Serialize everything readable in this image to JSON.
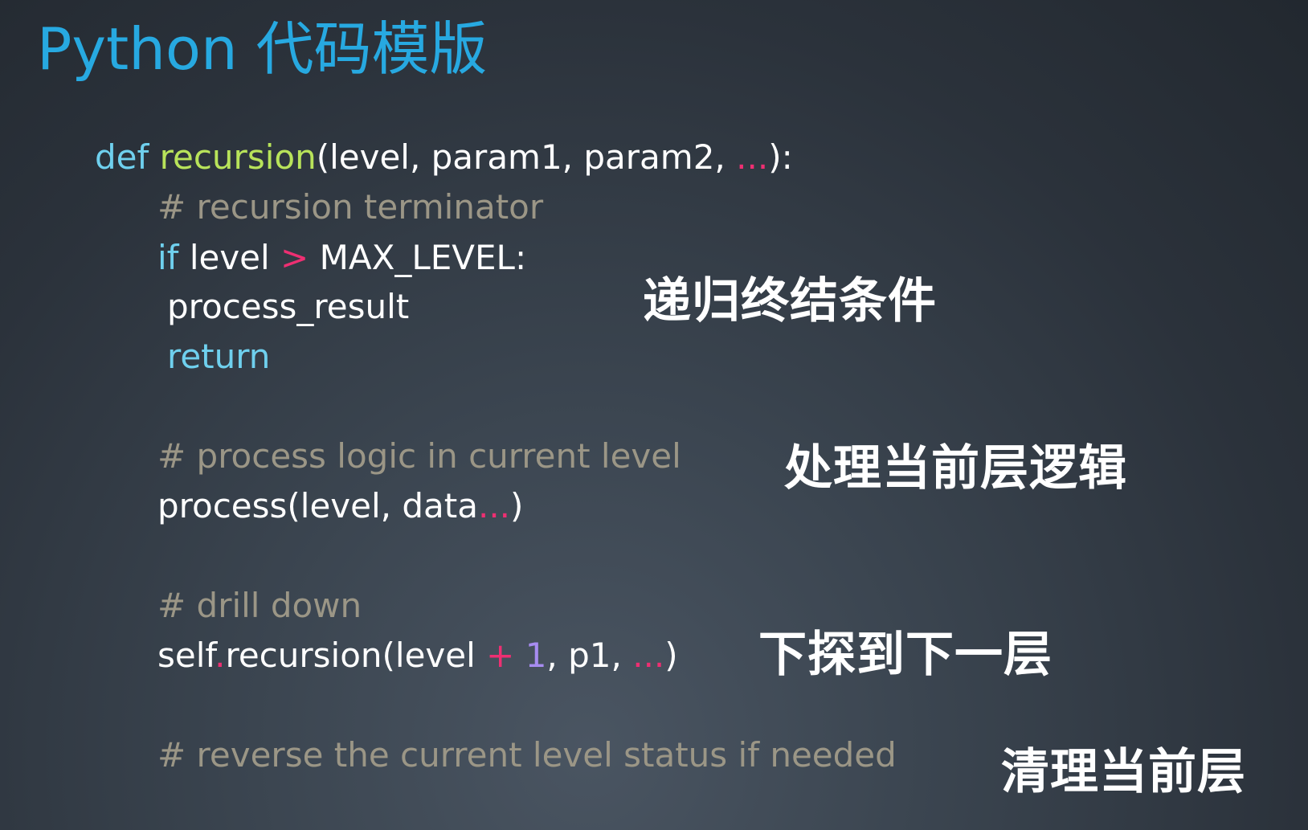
{
  "title": "Python 代码模版",
  "code": {
    "line1": {
      "def": "def",
      "space": " ",
      "func_name": "recursion",
      "params": "(level, param1, param2, ",
      "ellipsis": "...",
      "end": "):"
    },
    "line2": {
      "comment": "# recursion terminator"
    },
    "line3": {
      "if": "if",
      "cond_a": " level ",
      "gt": ">",
      "cond_b": " MAX_LEVEL:"
    },
    "line4": {
      "text": "process_result"
    },
    "line5": {
      "return": "return"
    },
    "line6": {
      "comment": "# process logic in current level"
    },
    "line7": {
      "call": "process(level, data",
      "ellipsis": "...",
      "end": ")"
    },
    "line8": {
      "comment": "# drill down"
    },
    "line9": {
      "self": "self",
      "dot": ".",
      "call": "recursion(level ",
      "plus": "+",
      "space": " ",
      "one": "1",
      "rest": ", p1, ",
      "ellipsis": "...",
      "end": ")"
    },
    "line10": {
      "comment": "# reverse the current level status if needed"
    }
  },
  "annotations": {
    "terminator": "递归终结条件",
    "process": "处理当前层逻辑",
    "drill": "下探到下一层",
    "cleanup": "清理当前层"
  }
}
